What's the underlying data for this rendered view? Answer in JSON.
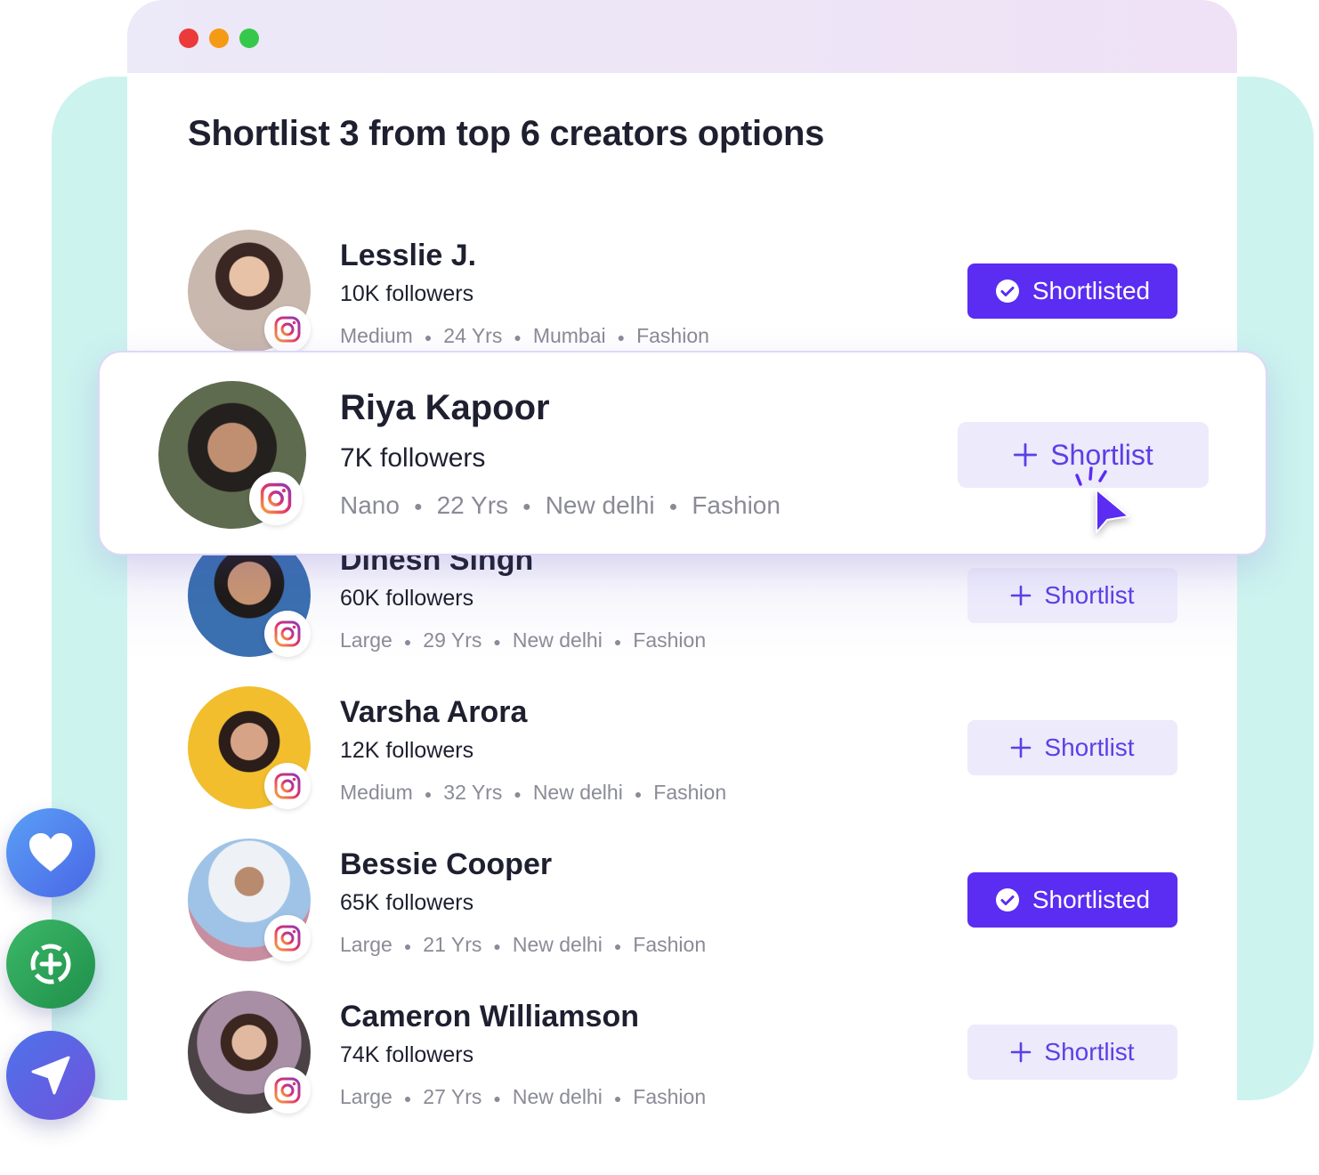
{
  "page": {
    "title": "Shortlist 3 from top 6 creators options"
  },
  "window_controls": [
    "close",
    "minimize",
    "maximize"
  ],
  "creators": [
    {
      "name": "Lesslie J.",
      "followers": "10K followers",
      "tier": "Medium",
      "age": "24 Yrs",
      "city": "Mumbai",
      "category": "Fashion",
      "status": "Shortlisted",
      "shortlisted": true,
      "platform_icon": "instagram-icon"
    },
    {
      "name": "Riya Kapoor",
      "followers": "7K followers",
      "tier": "Nano",
      "age": "22 Yrs",
      "city": "New delhi",
      "category": "Fashion",
      "status": "Shortlist",
      "shortlisted": false,
      "platform_icon": "instagram-icon"
    },
    {
      "name": "Dinesh Singh",
      "followers": "60K followers",
      "tier": "Large",
      "age": "29 Yrs",
      "city": "New delhi",
      "category": "Fashion",
      "status": "Shortlist",
      "shortlisted": false,
      "platform_icon": "instagram-icon"
    },
    {
      "name": "Varsha Arora",
      "followers": "12K followers",
      "tier": "Medium",
      "age": "32 Yrs",
      "city": "New delhi",
      "category": "Fashion",
      "status": "Shortlist",
      "shortlisted": false,
      "platform_icon": "instagram-icon"
    },
    {
      "name": "Bessie Cooper",
      "followers": "65K followers",
      "tier": "Large",
      "age": "21 Yrs",
      "city": "New delhi",
      "category": "Fashion",
      "status": "Shortlisted",
      "shortlisted": true,
      "platform_icon": "instagram-icon"
    },
    {
      "name": "Cameron Williamson",
      "followers": "74K followers",
      "tier": "Large",
      "age": "27 Yrs",
      "city": "New delhi",
      "category": "Fashion",
      "status": "Shortlist",
      "shortlisted": false,
      "platform_icon": "instagram-icon"
    }
  ],
  "side_actions": [
    {
      "icon": "heart-icon"
    },
    {
      "icon": "add-circle-icon"
    },
    {
      "icon": "send-icon"
    }
  ],
  "colors": {
    "accent": "#5b2cf2",
    "button_light": "#eceafb",
    "button_text": "#5d3fe6",
    "teal_background": "#cdf3ef",
    "instagram": "#e1306c"
  }
}
